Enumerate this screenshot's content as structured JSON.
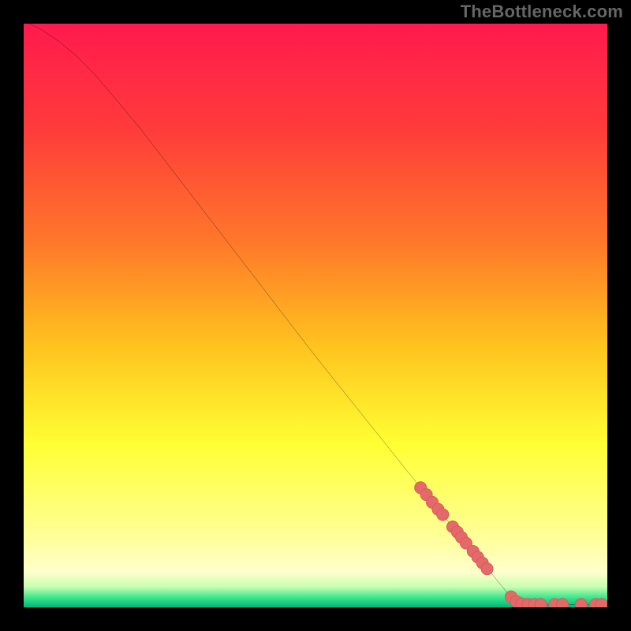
{
  "watermark": "TheBottleneck.com",
  "chart_data": {
    "type": "line",
    "title": "",
    "xlabel": "",
    "ylabel": "",
    "xlim": [
      0,
      100
    ],
    "ylim": [
      0,
      100
    ],
    "background_gradient": {
      "direction": "vertical",
      "stops": [
        {
          "offset": 0.0,
          "color": "#ff1a4d"
        },
        {
          "offset": 0.18,
          "color": "#ff3b3b"
        },
        {
          "offset": 0.38,
          "color": "#ff7a2a"
        },
        {
          "offset": 0.55,
          "color": "#ffc21f"
        },
        {
          "offset": 0.72,
          "color": "#ffff33"
        },
        {
          "offset": 0.88,
          "color": "#ffff99"
        },
        {
          "offset": 0.94,
          "color": "#ffffcc"
        },
        {
          "offset": 0.965,
          "color": "#c7ffb0"
        },
        {
          "offset": 0.985,
          "color": "#2fe38a"
        },
        {
          "offset": 1.0,
          "color": "#08b27a"
        }
      ]
    },
    "series": [
      {
        "name": "curve",
        "stroke": "#000000",
        "stroke_width": 2.2,
        "points": [
          {
            "x": 1,
            "y": 100
          },
          {
            "x": 3,
            "y": 99
          },
          {
            "x": 6,
            "y": 97
          },
          {
            "x": 9,
            "y": 94.5
          },
          {
            "x": 12,
            "y": 91.5
          },
          {
            "x": 15,
            "y": 88
          },
          {
            "x": 20,
            "y": 82
          },
          {
            "x": 30,
            "y": 69
          },
          {
            "x": 40,
            "y": 56
          },
          {
            "x": 50,
            "y": 43
          },
          {
            "x": 60,
            "y": 30.5
          },
          {
            "x": 68,
            "y": 20.5
          },
          {
            "x": 70,
            "y": 18
          },
          {
            "x": 75,
            "y": 12
          },
          {
            "x": 80,
            "y": 6
          },
          {
            "x": 83,
            "y": 2.3
          },
          {
            "x": 85,
            "y": 0.7
          },
          {
            "x": 88,
            "y": 0.5
          },
          {
            "x": 92,
            "y": 0.5
          },
          {
            "x": 96,
            "y": 0.5
          },
          {
            "x": 99,
            "y": 0.5
          }
        ]
      }
    ],
    "markers": {
      "name": "highlight-dots",
      "fill": "#e46a6a",
      "stroke": "#d85a5a",
      "r": 7.5,
      "points": [
        {
          "x": 68.0,
          "y": 20.5
        },
        {
          "x": 69.0,
          "y": 19.3
        },
        {
          "x": 70.0,
          "y": 18.0
        },
        {
          "x": 71.0,
          "y": 16.8
        },
        {
          "x": 71.8,
          "y": 15.9
        },
        {
          "x": 73.5,
          "y": 13.8
        },
        {
          "x": 74.3,
          "y": 12.9
        },
        {
          "x": 75.0,
          "y": 12.0
        },
        {
          "x": 75.8,
          "y": 11.0
        },
        {
          "x": 77.0,
          "y": 9.6
        },
        {
          "x": 77.8,
          "y": 8.6
        },
        {
          "x": 78.6,
          "y": 7.6
        },
        {
          "x": 79.4,
          "y": 6.6
        },
        {
          "x": 83.5,
          "y": 1.8
        },
        {
          "x": 84.4,
          "y": 1.0
        },
        {
          "x": 85.3,
          "y": 0.6
        },
        {
          "x": 86.4,
          "y": 0.5
        },
        {
          "x": 87.5,
          "y": 0.5
        },
        {
          "x": 88.6,
          "y": 0.5
        },
        {
          "x": 91.0,
          "y": 0.5
        },
        {
          "x": 92.3,
          "y": 0.5
        },
        {
          "x": 95.5,
          "y": 0.5
        },
        {
          "x": 98.0,
          "y": 0.5
        },
        {
          "x": 99.0,
          "y": 0.5
        }
      ]
    }
  }
}
